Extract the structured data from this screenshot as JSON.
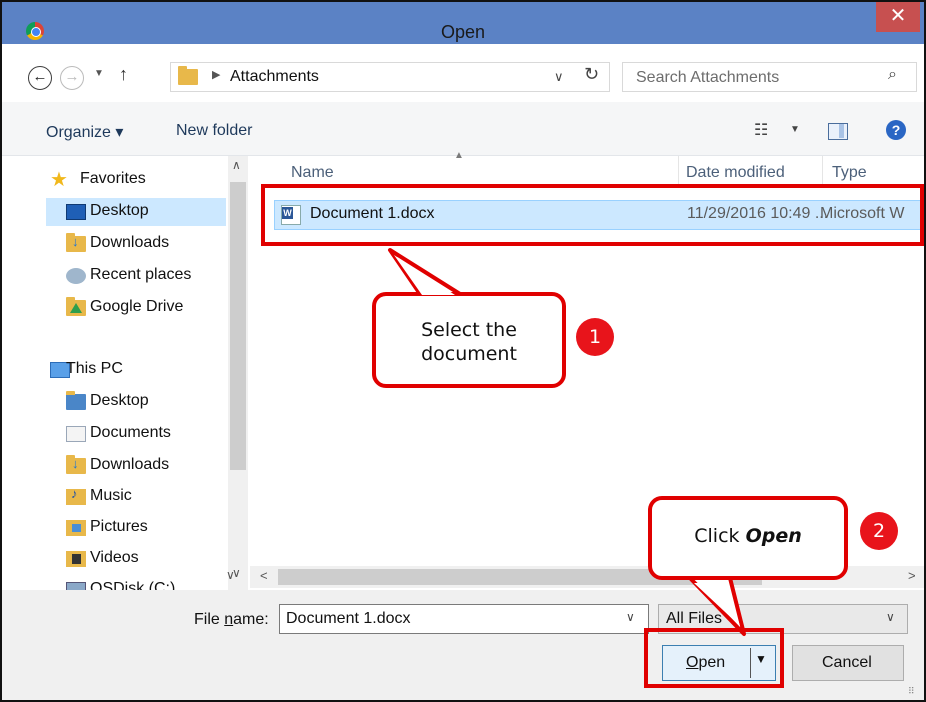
{
  "window": {
    "title": "Open",
    "close_glyph": "✕"
  },
  "address": {
    "path_label": "Attachments",
    "search_placeholder": "Search Attachments"
  },
  "toolbar": {
    "organize_label": "Organize ▾",
    "new_folder_label": "New folder"
  },
  "nav": {
    "favorites_label": "Favorites",
    "favorites_items": [
      {
        "label": "Desktop",
        "icon": "desktop-icon"
      },
      {
        "label": "Downloads",
        "icon": "downloads-folder-icon"
      },
      {
        "label": "Recent places",
        "icon": "recent-places-icon"
      },
      {
        "label": "Google Drive",
        "icon": "google-drive-folder-icon"
      }
    ],
    "this_pc_label": "This PC",
    "this_pc_items": [
      {
        "label": "Desktop",
        "icon": "desktop-folder-icon"
      },
      {
        "label": "Documents",
        "icon": "documents-folder-icon"
      },
      {
        "label": "Downloads",
        "icon": "downloads-folder-icon"
      },
      {
        "label": "Music",
        "icon": "music-folder-icon"
      },
      {
        "label": "Pictures",
        "icon": "pictures-folder-icon"
      },
      {
        "label": "Videos",
        "icon": "videos-folder-icon"
      },
      {
        "label": "OSDisk (C:)",
        "icon": "disk-drive-icon"
      }
    ]
  },
  "filelist": {
    "columns": [
      "Name",
      "Date modified",
      "Type"
    ],
    "rows": [
      {
        "name": "Document 1.docx",
        "date": "11/29/2016 10:49 ...",
        "type": "Microsoft W",
        "icon": "word-document-icon",
        "selected": true
      }
    ]
  },
  "bottom": {
    "file_name_label_pre": "File ",
    "file_name_label_u": "n",
    "file_name_label_post": "ame:",
    "file_name_value": "Document 1.docx",
    "file_type_value": "All Files",
    "open_label_u": "O",
    "open_label_rest": "pen",
    "cancel_label": "Cancel"
  },
  "annotations": {
    "step1_text_line1": "Select the",
    "step1_text_line2": "document",
    "step1_number": "1",
    "step2_text": "Click ",
    "step2_emph": "Open",
    "step2_number": "2",
    "accent_color": "#e00000"
  }
}
